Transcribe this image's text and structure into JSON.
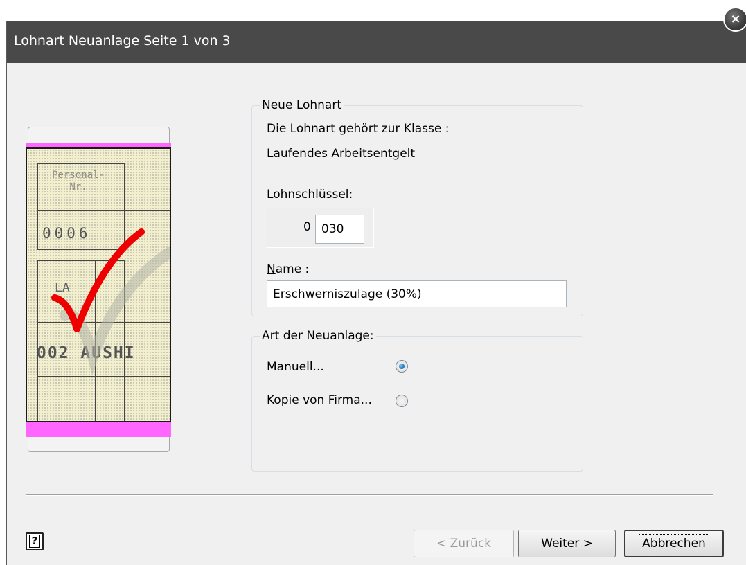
{
  "window": {
    "title": "Lohnart Neuanlage Seite 1 von 3",
    "close_glyph": "×"
  },
  "illustration": {
    "cell_personal_label": "Personal-\nNr.",
    "cell_personal_value": "0006",
    "cell_la_label": "LA",
    "cell_la_value": "002 AUSHI"
  },
  "neue_lohnart": {
    "legend": "Neue Lohnart",
    "class_line1": "Die Lohnart gehört zur Klasse :",
    "class_line2": "Laufendes Arbeitsentgelt",
    "key_label_prefix": "L",
    "key_label_rest": "ohnschlüssel:",
    "key_prefix": "0",
    "key_value": "030",
    "name_label_prefix": "N",
    "name_label_rest": "ame :",
    "name_value": "Erschwerniszulage (30%)"
  },
  "art_der_neuanlage": {
    "legend": "Art der Neuanlage:",
    "options": [
      {
        "label": "Manuell...",
        "checked": true
      },
      {
        "label": "Kopie von Firma...",
        "checked": false
      }
    ]
  },
  "buttons": {
    "help_glyph": "?",
    "back_prefix": "< ",
    "back_underline": "Z",
    "back_rest": "urück",
    "next_underline": "W",
    "next_rest": "eiter >",
    "cancel": "Abbrechen"
  },
  "colors": {
    "titlebar": "#494949",
    "illustration_band": "#ff66ff",
    "check_mark": "#ee0000",
    "radio_selected": "#1a6fb0"
  }
}
